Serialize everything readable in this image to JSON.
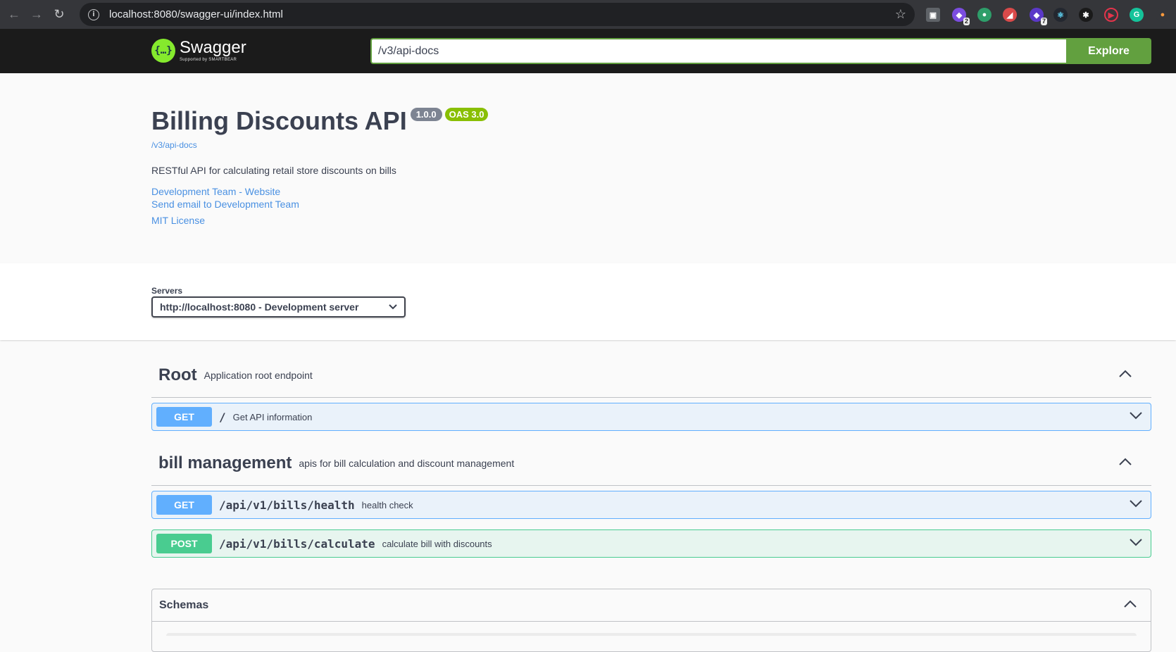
{
  "browser": {
    "url": "localhost:8080/swagger-ui/index.html",
    "ext_badges": [
      "2",
      "7"
    ]
  },
  "topbar": {
    "logo_name": "Swagger",
    "logo_sub": "Supported by SMARTBEAR",
    "spec_url": "/v3/api-docs",
    "explore_label": "Explore"
  },
  "info": {
    "title": "Billing Discounts API",
    "version": "1.0.0",
    "oas": "OAS 3.0",
    "spec_link": "/v3/api-docs",
    "description": "RESTful API for calculating retail store discounts on bills",
    "links": [
      "Development Team - Website",
      "Send email to Development Team",
      "MIT License"
    ]
  },
  "servers": {
    "label": "Servers",
    "selected": "http://localhost:8080 - Development server"
  },
  "tags": [
    {
      "name": "Root",
      "description": "Application root endpoint",
      "operations": [
        {
          "method": "GET",
          "path": "/",
          "summary": "Get API information"
        }
      ]
    },
    {
      "name": "bill management",
      "description": "apis for bill calculation and discount management",
      "operations": [
        {
          "method": "GET",
          "path": "/api/v1/bills/health",
          "summary": "health check"
        },
        {
          "method": "POST",
          "path": "/api/v1/bills/calculate",
          "summary": "calculate bill with discounts"
        }
      ]
    }
  ],
  "schemas": {
    "label": "Schemas"
  },
  "colors": {
    "get": "#61affe",
    "post": "#49cc90",
    "explore": "#62a03f",
    "oas_badge": "#89bf04",
    "version_badge": "#7d8492",
    "link": "#4990e2"
  }
}
